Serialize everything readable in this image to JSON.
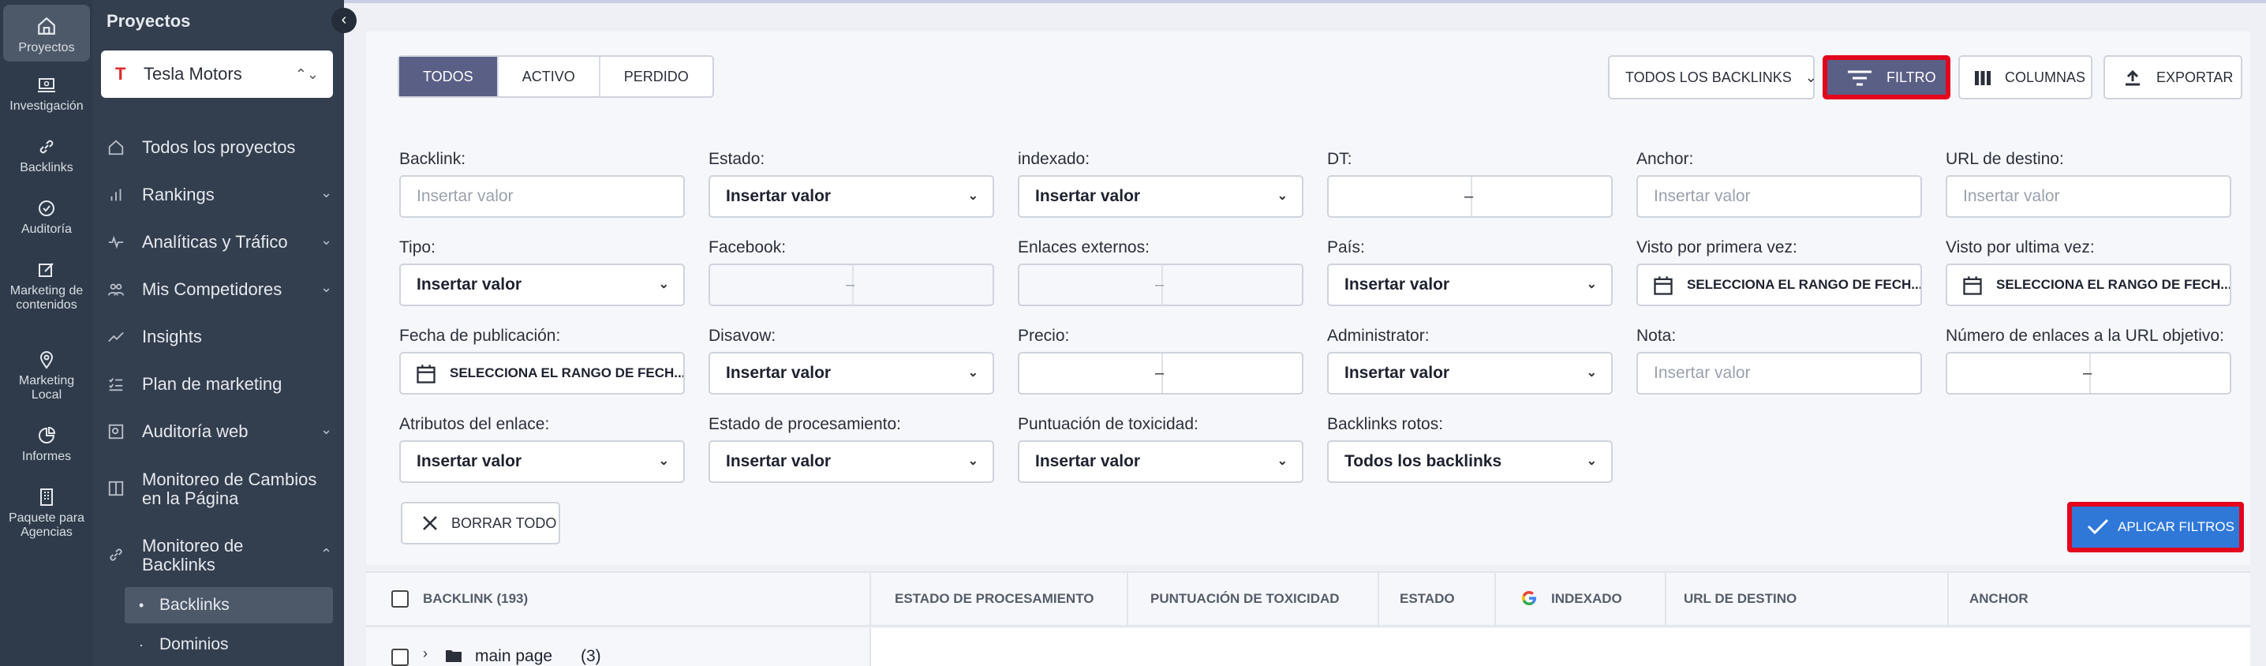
{
  "rail": {
    "items": [
      {
        "label": "Proyectos",
        "icon": "home-icon"
      },
      {
        "label": "Investigación",
        "icon": "laptop-search-icon"
      },
      {
        "label": "Backlinks",
        "icon": "link-icon"
      },
      {
        "label": "Auditoría",
        "icon": "check-circle-icon"
      },
      {
        "label": "Marketing de contenidos",
        "icon": "edit-icon"
      },
      {
        "label": "Marketing Local",
        "icon": "location-pin-icon"
      },
      {
        "label": "Informes",
        "icon": "pie-chart-icon"
      },
      {
        "label": "Paquete para Agencias",
        "icon": "building-icon"
      }
    ]
  },
  "sidebar": {
    "title": "Proyectos",
    "project": "Tesla Motors",
    "items": [
      {
        "label": "Todos los proyectos"
      },
      {
        "label": "Rankings"
      },
      {
        "label": "Analíticas y Tráfico"
      },
      {
        "label": "Mis Competidores"
      },
      {
        "label": "Insights"
      },
      {
        "label": "Plan de marketing"
      },
      {
        "label": "Auditoría web"
      },
      {
        "label": "Monitoreo de Cambios en la Página"
      },
      {
        "label": "Monitoreo de Backlinks"
      }
    ],
    "subitems": [
      {
        "label": "Backlinks"
      },
      {
        "label": "Dominios"
      }
    ]
  },
  "toolbar": {
    "tabs": [
      "TODOS",
      "ACTIVO",
      "PERDIDO"
    ],
    "all_backlinks": "TODOS LOS BACKLINKS",
    "filter": "FILTRO",
    "columns": "COLUMNAS",
    "export": "EXPORTAR"
  },
  "filters": {
    "labels": {
      "backlink": "Backlink:",
      "estado": "Estado:",
      "indexado": "indexado:",
      "dt": "DT:",
      "anchor": "Anchor:",
      "url_destino": "URL de destino:",
      "tipo": "Tipo:",
      "facebook": "Facebook:",
      "enlaces_externos": "Enlaces externos:",
      "pais": "País:",
      "visto_primera": "Visto por primera vez:",
      "visto_ultima": "Visto por ultima vez:",
      "fecha_publicacion": "Fecha de publicación:",
      "disavow": "Disavow:",
      "precio": "Precio:",
      "administrator": "Administrator:",
      "nota": "Nota:",
      "num_enlaces": "Número de enlaces a la URL objetivo:",
      "atributos": "Atributos del enlace:",
      "estado_procesamiento": "Estado de procesamiento:",
      "toxicidad": "Puntuación de toxicidad:",
      "rotos": "Backlinks rotos:"
    },
    "placeholder": "Insertar valor",
    "select_value": "Insertar valor",
    "date_range": "SELECCIONA EL RANGO DE FECH...",
    "broken_value": "Todos los backlinks",
    "range_dash": "–",
    "clear_all": "BORRAR TODO",
    "apply": "APLICAR FILTROS"
  },
  "table": {
    "columns": [
      "BACKLINK (193)",
      "ESTADO DE PROCESAMIENTO",
      "PUNTUACIÓN DE TOXICIDAD",
      "ESTADO",
      "INDEXADO",
      "URL DE DESTINO",
      "ANCHOR"
    ],
    "rows": [
      {
        "name": "main page",
        "count": "(3)"
      }
    ]
  },
  "colors": {
    "accent": "#5a5f86",
    "apply": "#2f78d8",
    "highlight": "#e3061d",
    "rail": "#2f3b4a",
    "sidebar": "#333e4e"
  }
}
